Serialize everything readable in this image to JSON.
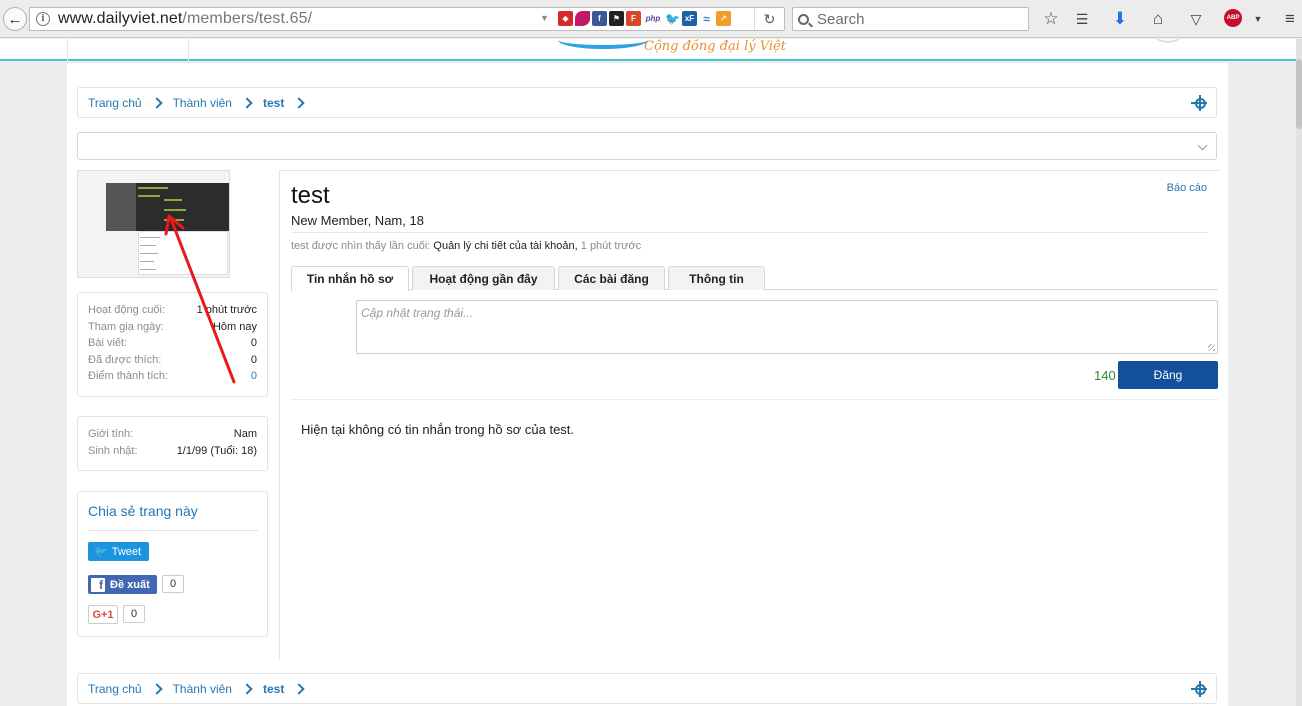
{
  "browser": {
    "url_host": "www.dailyviet.net",
    "url_path": "/members/test.65/",
    "search_placeholder": "Search",
    "abp_label": "ABP",
    "ext_php": "php",
    "ext_xf": "xF"
  },
  "header": {
    "slogan": "Cộng đồng đại lý Việt"
  },
  "breadcrumb": {
    "items": [
      "Trang chủ",
      "Thành viên",
      "test"
    ]
  },
  "profile": {
    "username": "test",
    "user_title": "New Member, Nam, 18",
    "report_label": "Báo cáo",
    "last_seen_label": "test được nhìn thấy lần cuối:",
    "last_seen_activity": "Quản lý chi tiết của tài khoản,",
    "last_seen_time": "1 phút trước"
  },
  "stats": [
    {
      "label": "Hoạt động cuối:",
      "value": "1 phút trước"
    },
    {
      "label": "Tham gia ngày:",
      "value": "Hôm nay"
    },
    {
      "label": "Bài viết:",
      "value": "0"
    },
    {
      "label": "Đã được thích:",
      "value": "0"
    },
    {
      "label": "Điểm thành tích:",
      "value": "0"
    }
  ],
  "info": [
    {
      "label": "Giới tính:",
      "value": "Nam"
    },
    {
      "label": "Sinh nhật:",
      "value": "1/1/99 (Tuổi: 18)"
    }
  ],
  "share": {
    "title": "Chia sẻ trang này",
    "tweet_label": "Tweet",
    "fb_label": "Đề xuất",
    "fb_count": "0",
    "gplus_label": "G+1",
    "gplus_count": "0"
  },
  "tabs": [
    "Tin nhắn hồ sơ",
    "Hoạt động gần đây",
    "Các bài đăng",
    "Thông tin"
  ],
  "status": {
    "placeholder": "Cập nhật trạng thái...",
    "char_count": "140",
    "post_label": "Đăng"
  },
  "empty_message": "Hiện tại không có tin nhắn trong hồ sơ của test.",
  "colors": {
    "accent": "#2577b1",
    "header_line": "#41c6d6",
    "post_button": "#12509c",
    "annotation_arrow": "#e8191c"
  }
}
